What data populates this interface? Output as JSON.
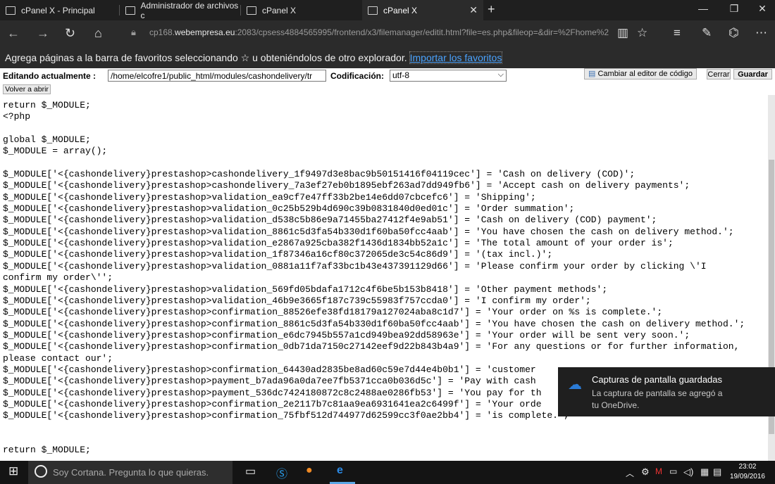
{
  "tabs": [
    {
      "label": "cPanel X - Principal"
    },
    {
      "label": "Administrador de archivos c"
    },
    {
      "label": "cPanel X"
    },
    {
      "label": "cPanel X",
      "active": true
    }
  ],
  "address": {
    "prefix": "cp168.",
    "domain": "webempresa.eu",
    "rest": ":2083/cpsess4884565995/frontend/x3/filemanager/editit.html?file=es.php&fileop=&dir=%2Fhome%2Felcofre"
  },
  "favbar": {
    "text": "Agrega páginas a la barra de favoritos seleccionando ☆ u obteniéndolos de otro explorador.",
    "link": "Importar los favoritos"
  },
  "editor": {
    "editing_label": "Editando actualmente :",
    "path": "/home/elcofre1/public_html/modules/cashondelivery/tr",
    "encoding_label": "Codificación:",
    "encoding": "utf-8",
    "code_editor_button": "Cambiar al editor de código",
    "close_button": "Cerrar",
    "save_button": "Guardar",
    "reopen_button": "Volver a abrir"
  },
  "code": "return $_MODULE;\n<?php\n\nglobal $_MODULE;\n$_MODULE = array();\n\n$_MODULE['<{cashondelivery}prestashop>cashondelivery_1f9497d3e8bac9b50151416f04119cec'] = 'Cash on delivery (COD)';\n$_MODULE['<{cashondelivery}prestashop>cashondelivery_7a3ef27eb0b1895ebf263ad7dd949fb6'] = 'Accept cash on delivery payments';\n$_MODULE['<{cashondelivery}prestashop>validation_ea9cf7e47ff33b2be14e6dd07cbcefc6'] = 'Shipping';\n$_MODULE['<{cashondelivery}prestashop>validation_0c25b529b4d690c39b0831840d0ed01c'] = 'Order summation';\n$_MODULE['<{cashondelivery}prestashop>validation_d538c5b86e9a71455ba27412f4e9ab51'] = 'Cash on delivery (COD) payment';\n$_MODULE['<{cashondelivery}prestashop>validation_8861c5d3fa54b330d1f60ba50fcc4aab'] = 'You have chosen the cash on delivery method.';\n$_MODULE['<{cashondelivery}prestashop>validation_e2867a925cba382f1436d1834bb52a1c'] = 'The total amount of your order is';\n$_MODULE['<{cashondelivery}prestashop>validation_1f87346a16cf80c372065de3c54c86d9'] = '(tax incl.)';\n$_MODULE['<{cashondelivery}prestashop>validation_0881a11f7af33bc1b43e437391129d66'] = 'Please confirm your order by clicking \\'I\nconfirm my order\\'';\n$_MODULE['<{cashondelivery}prestashop>validation_569fd05bdafa1712c4f6be5b153b8418'] = 'Other payment methods';\n$_MODULE['<{cashondelivery}prestashop>validation_46b9e3665f187c739c55983f757ccda0'] = 'I confirm my order';\n$_MODULE['<{cashondelivery}prestashop>confirmation_88526efe38fd18179a127024aba8c1d7'] = 'Your order on %s is complete.';\n$_MODULE['<{cashondelivery}prestashop>confirmation_8861c5d3fa54b330d1f60ba50fcc4aab'] = 'You have chosen the cash on delivery method.';\n$_MODULE['<{cashondelivery}prestashop>confirmation_e6dc7945b557a1cd949bea92dd58963e'] = 'Your order will be sent very soon.';\n$_MODULE['<{cashondelivery}prestashop>confirmation_0db71da7150c27142eef9d22b843b4a9'] = 'For any questions or for further information,\nplease contact our';\n$_MODULE['<{cashondelivery}prestashop>confirmation_64430ad2835be8ad60c59e7d44e4b0b1'] = 'customer\n$_MODULE['<{cashondelivery}prestashop>payment_b7ada96a0da7ee7fb5371cca0b036d5c'] = 'Pay with cash\n$_MODULE['<{cashondelivery}prestashop>payment_536dc7424180872c8c2488ae0286fb53'] = 'You pay for th\n$_MODULE['<{cashondelivery}prestashop>confirmation_2e2117b7c81aa9ea6931641ea2c6499f'] = 'Your orde\n$_MODULE['<{cashondelivery}prestashop>confirmation_75fbf512d744977d62599cc3f0ae2bb4'] = 'is complete.';\n\n\nreturn $_MODULE;",
  "toast": {
    "title": "Capturas de pantalla guardadas",
    "line1": "La captura de pantalla se agregó a",
    "line2": "tu OneDrive."
  },
  "taskbar": {
    "search_placeholder": "Soy Cortana. Pregunta lo que quieras.",
    "time": "23:02",
    "date": "19/09/2016"
  }
}
